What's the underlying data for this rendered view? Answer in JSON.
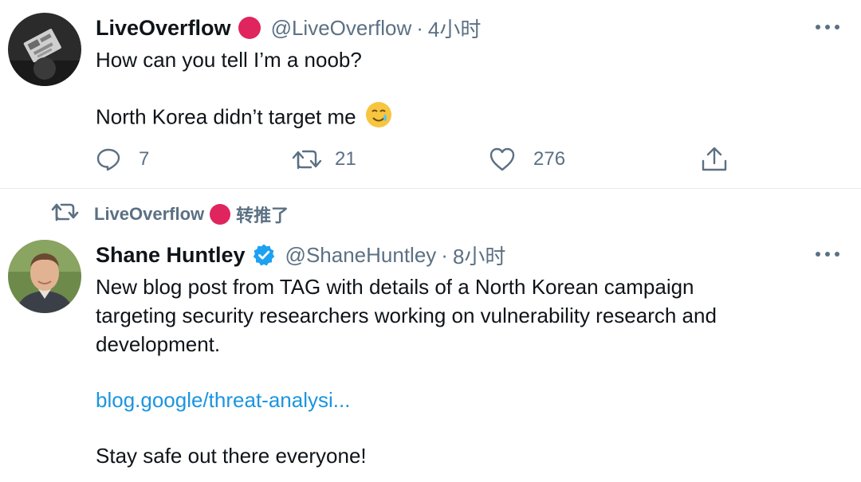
{
  "tweet1": {
    "name": "LiveOverflow",
    "handle": "@LiveOverflow",
    "separator": "·",
    "time": "4小时",
    "lines": [
      "How can you tell I’m a noob?",
      "North Korea didn’t target me"
    ],
    "emoji": "🥲",
    "actions": {
      "reply_count": "7",
      "retweet_count": "21",
      "like_count": "276"
    },
    "colors": {
      "badge": "#e0245e"
    }
  },
  "tweet2": {
    "retweeted_by": "LiveOverflow",
    "retweet_label": "转推了",
    "name": "Shane Huntley",
    "handle": "@ShaneHuntley",
    "separator": "·",
    "time": "8小时",
    "lines": [
      "New blog post from TAG with details of a North Korean campaign",
      "targeting security researchers working on vulnerability research and",
      "development."
    ],
    "link": "blog.google/threat-analysi...",
    "closing": "Stay safe out there everyone!",
    "colors": {
      "verified": "#1da1f2",
      "link": "#1b95e0"
    }
  },
  "icons": {
    "more": "more-icon",
    "reply": "reply-icon",
    "retweet": "retweet-icon",
    "like": "heart-icon",
    "share": "share-icon",
    "verified": "verified-badge-icon"
  }
}
